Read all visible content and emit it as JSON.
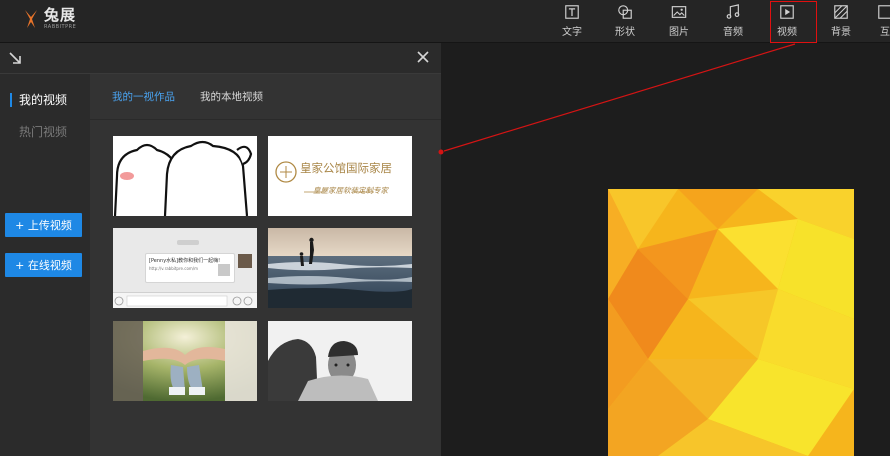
{
  "app": {
    "name": "兔展",
    "name_en": "RABBITPRE"
  },
  "toolbar": {
    "items": [
      {
        "label": "文字",
        "icon": "text-icon"
      },
      {
        "label": "形状",
        "icon": "shape-icon"
      },
      {
        "label": "图片",
        "icon": "image-icon"
      },
      {
        "label": "音频",
        "icon": "music-icon"
      },
      {
        "label": "视频",
        "icon": "video-icon"
      },
      {
        "label": "背景",
        "icon": "background-icon"
      },
      {
        "label": "互",
        "icon": "interact-icon"
      }
    ],
    "highlight_color": "#e01010"
  },
  "video_panel": {
    "sidebar": {
      "my_videos": "我的视频",
      "hot_videos": "热门视频"
    },
    "buttons": {
      "upload": "+ 上传视频",
      "online": "+ 在线视频"
    },
    "tabs": {
      "works": "我的一视作品",
      "local": "我的本地视频"
    },
    "thumbs": {
      "luxury_title": "皇家公馆国际家居",
      "luxury_sub": "皇屋家居软装定制专家",
      "chat_text": "[Penny水私]教你和我们一起嗨!",
      "chat_link": "http://v.rabbitpre.com/m"
    }
  },
  "colors": {
    "accent": "#1e88e5",
    "tab_active": "#4aa3f0"
  }
}
